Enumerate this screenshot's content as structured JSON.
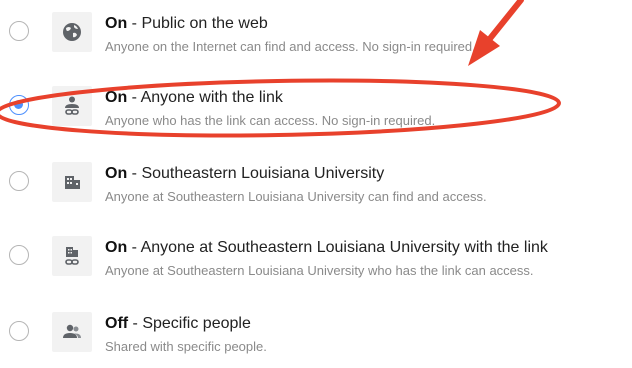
{
  "sharing_options": [
    {
      "status": "On",
      "separator": " - ",
      "title": "Public on the web",
      "description": "Anyone on the Internet can find and access. No sign-in required.",
      "icon": "globe-icon",
      "selected": false
    },
    {
      "status": "On",
      "separator": " - ",
      "title": "Anyone with the link",
      "description": "Anyone who has the link can access. No sign-in required.",
      "icon": "person-link-icon",
      "selected": true
    },
    {
      "status": "On",
      "separator": " - ",
      "title": "Southeastern Louisiana University",
      "description": "Anyone at Southeastern Louisiana University can find and access.",
      "icon": "building-icon",
      "selected": false
    },
    {
      "status": "On",
      "separator": " - ",
      "title": "Anyone at Southeastern Louisiana University with the link",
      "description": "Anyone at Southeastern Louisiana University who has the link can access.",
      "icon": "building-link-icon",
      "selected": false
    },
    {
      "status": "Off",
      "separator": " - ",
      "title": "Specific people",
      "description": "Shared with specific people.",
      "icon": "people-icon",
      "selected": false
    }
  ],
  "colors": {
    "radio_selected": "#4d90fe",
    "annotation": "#e8412c"
  }
}
